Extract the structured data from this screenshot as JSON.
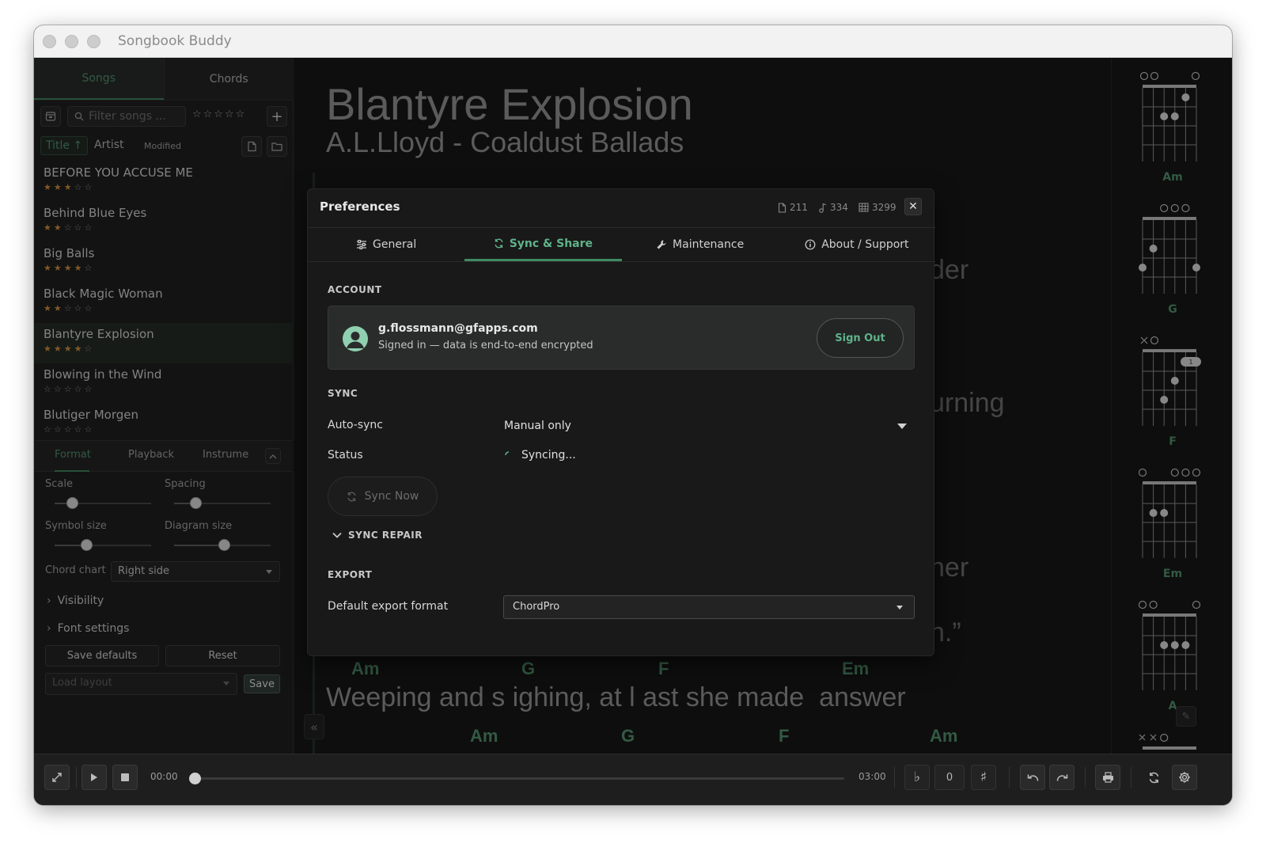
{
  "window": {
    "title": "Songbook Buddy"
  },
  "sidebar": {
    "tabs": [
      {
        "label": "Songs"
      },
      {
        "label": "Chords"
      }
    ],
    "filter_placeholder": "Filter songs ...",
    "sort": {
      "title": "Title ↑",
      "artist": "Artist",
      "modified": "Modified"
    },
    "songs": [
      {
        "name": "BEFORE YOU ACCUSE ME",
        "rating": 3
      },
      {
        "name": "Behind Blue Eyes",
        "rating": 2
      },
      {
        "name": "Big Balls",
        "rating": 4
      },
      {
        "name": "Black Magic Woman",
        "rating": 2
      },
      {
        "name": "Blantyre Explosion",
        "rating": 4
      },
      {
        "name": "Blowing in the Wind",
        "rating": 0
      },
      {
        "name": "Blutiger Morgen",
        "rating": 0
      }
    ],
    "bottom_tabs": [
      {
        "label": "Format"
      },
      {
        "label": "Playback"
      },
      {
        "label": "Instrume"
      }
    ],
    "format": {
      "scale_label": "Scale",
      "scale_value": 0.18,
      "spacing_label": "Spacing",
      "spacing_value": 0.22,
      "symbol_label": "Symbol size",
      "symbol_value": 0.33,
      "diagram_label": "Diagram size",
      "diagram_value": 0.52,
      "chord_chart_label": "Chord chart",
      "chord_chart_value": "Right side",
      "visibility": "Visibility",
      "font_settings": "Font settings",
      "save_defaults": "Save defaults",
      "reset": "Reset",
      "load_layout_placeholder": "Load layout",
      "save": "Save"
    }
  },
  "song": {
    "title": "Blantyre Explosion",
    "subtitle": "A.L.Lloyd - Coaldust Ballads",
    "fragments": [
      "der",
      "urning",
      "her",
      "n.”"
    ],
    "chord_line_1": [
      "Am",
      "G",
      "F",
      "Em"
    ],
    "lyric_line": "Weeping and s ighing, at l ast she made  answer",
    "chord_line_2": [
      "Am",
      "G",
      "F",
      "Am"
    ]
  },
  "chord_diagrams": [
    {
      "name": "Am"
    },
    {
      "name": "G"
    },
    {
      "name": "F"
    },
    {
      "name": "Em"
    },
    {
      "name": "A"
    }
  ],
  "preferences": {
    "title": "Preferences",
    "stats": [
      "211",
      "334",
      "3299"
    ],
    "tabs": [
      {
        "label": "General"
      },
      {
        "label": "Sync & Share"
      },
      {
        "label": "Maintenance"
      },
      {
        "label": "About / Support"
      }
    ],
    "account": {
      "heading": "ACCOUNT",
      "email": "g.flossmann@gfapps.com",
      "status": "Signed in — data is end-to-end encrypted",
      "sign_out": "Sign Out"
    },
    "sync": {
      "heading": "SYNC",
      "auto_label": "Auto-sync",
      "auto_value": "Manual only",
      "status_label": "Status",
      "status_value": "Syncing...",
      "sync_now": "Sync Now",
      "repair": "SYNC REPAIR"
    },
    "export": {
      "heading": "EXPORT",
      "format_label": "Default export format",
      "format_value": "ChordPro"
    }
  },
  "transport": {
    "current": "00:00",
    "total": "03:00",
    "progress": 0.0,
    "transpose": "0"
  },
  "colors": {
    "accent": "#4f8a68",
    "accent_bright": "#5fb38a",
    "star": "#c7893b"
  }
}
